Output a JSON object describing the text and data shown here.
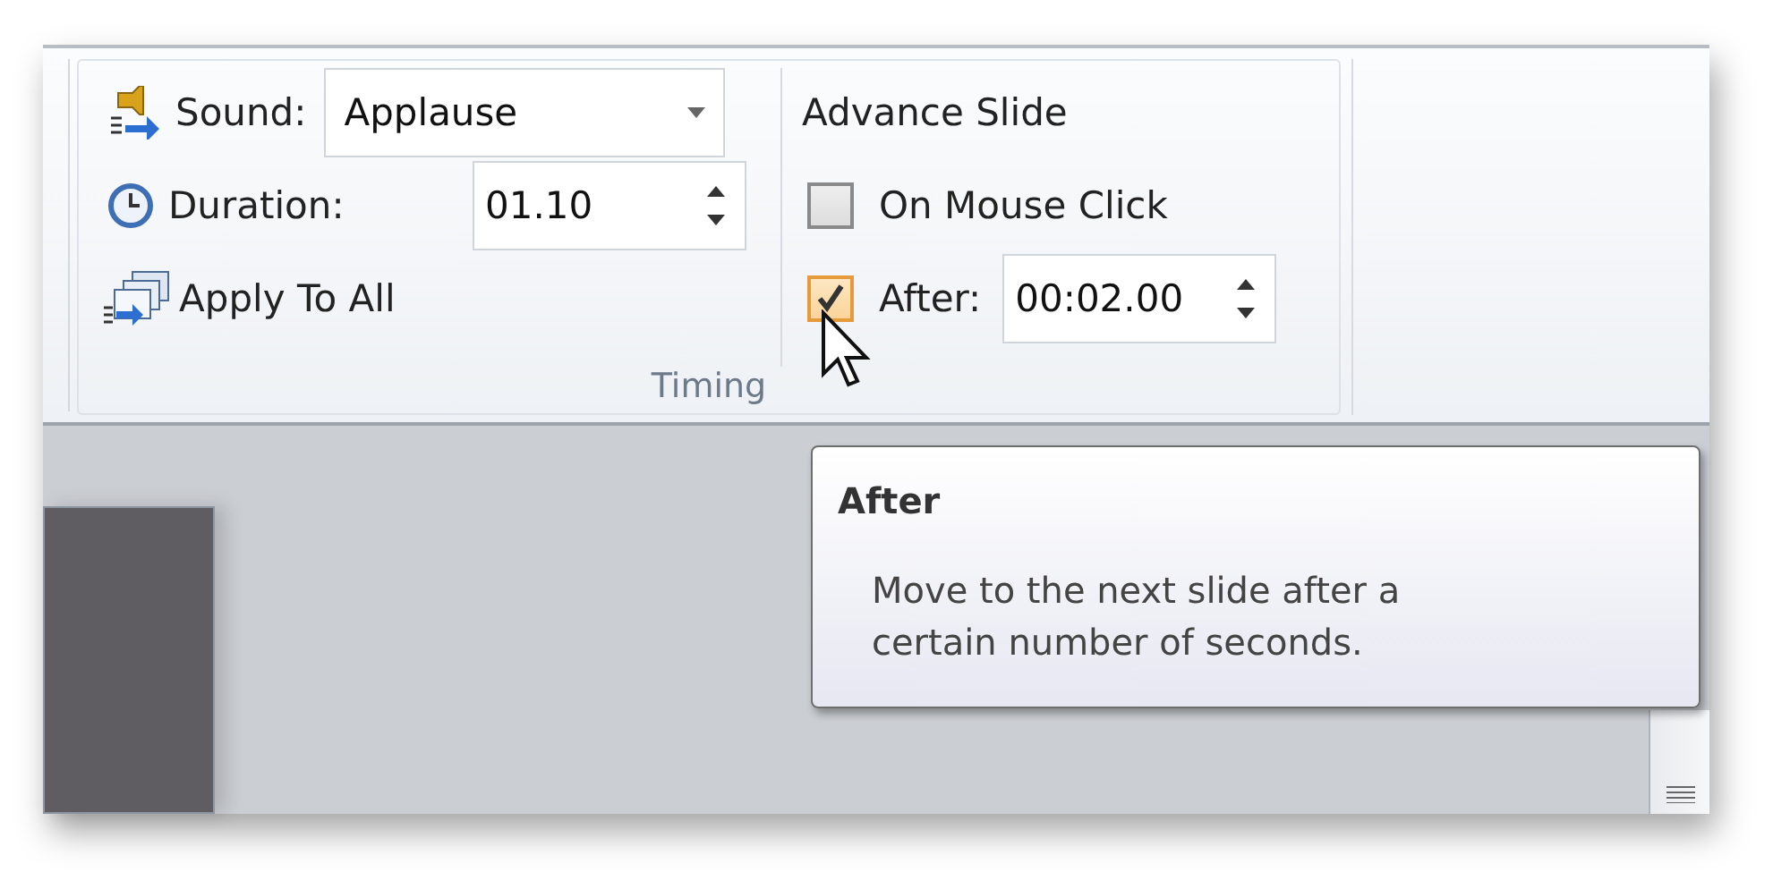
{
  "sound": {
    "label": "Sound:",
    "value": "Applause"
  },
  "duration": {
    "label": "Duration:",
    "value": "01.10"
  },
  "apply_to_all": "Apply To All",
  "group_label": "Timing",
  "advance_slide": {
    "title": "Advance Slide",
    "options": [
      {
        "kind": "checkbox",
        "label": "On Mouse Click",
        "checked": false
      },
      {
        "kind": "timed",
        "label": "After:",
        "checked": true,
        "value": "00:02.00"
      }
    ]
  },
  "tooltip": {
    "title": "After",
    "text": "Move to the next slide after a certain number of seconds."
  }
}
